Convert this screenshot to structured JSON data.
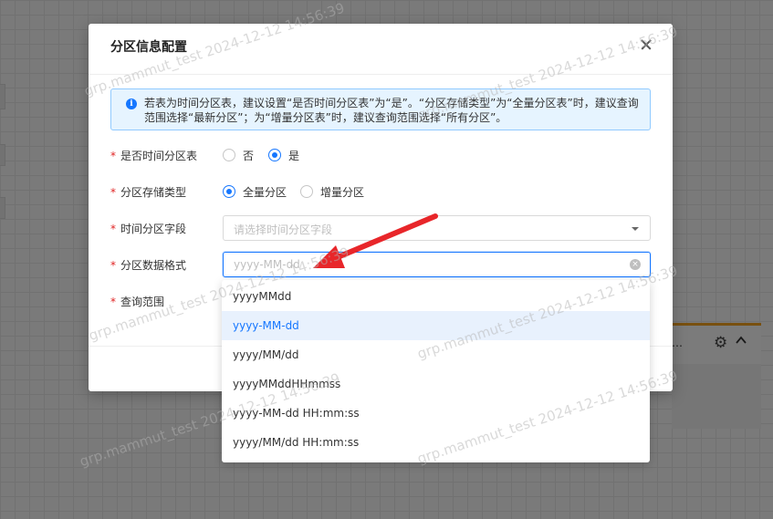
{
  "colors": {
    "primary": "#1677ff",
    "required": "#e02424",
    "alert_bg": "#e6f4ff",
    "accent_orange": "#f0a020"
  },
  "background": {
    "card_dots": "…"
  },
  "modal": {
    "title": "分区信息配置",
    "alert_text": "若表为时间分区表，建议设置“是否时间分区表”为“是”。“分区存储类型”为“全量分区表”时，建议查询范围选择“最新分区”；为“增量分区表”时，建议查询范围选择“所有分区”。",
    "fields": {
      "is_time_partition": {
        "label": "是否时间分区表",
        "options": [
          "否",
          "是"
        ],
        "selected": "是"
      },
      "storage_type": {
        "label": "分区存储类型",
        "options": [
          "全量分区",
          "增量分区"
        ],
        "selected": "全量分区"
      },
      "time_field": {
        "label": "时间分区字段",
        "placeholder": "请选择时间分区字段"
      },
      "data_format": {
        "label": "分区数据格式",
        "placeholder": "yyyy-MM-dd"
      },
      "query_range": {
        "label": "查询范围"
      }
    }
  },
  "dropdown": {
    "options": [
      "yyyyMMdd",
      "yyyy-MM-dd",
      "yyyy/MM/dd",
      "yyyyMMddHHmmss",
      "yyyy-MM-dd HH:mm:ss",
      "yyyy/MM/dd HH:mm:ss"
    ],
    "active": "yyyy-MM-dd"
  },
  "watermark": "grp.mammut_test 2024-12-12 14:56:39"
}
